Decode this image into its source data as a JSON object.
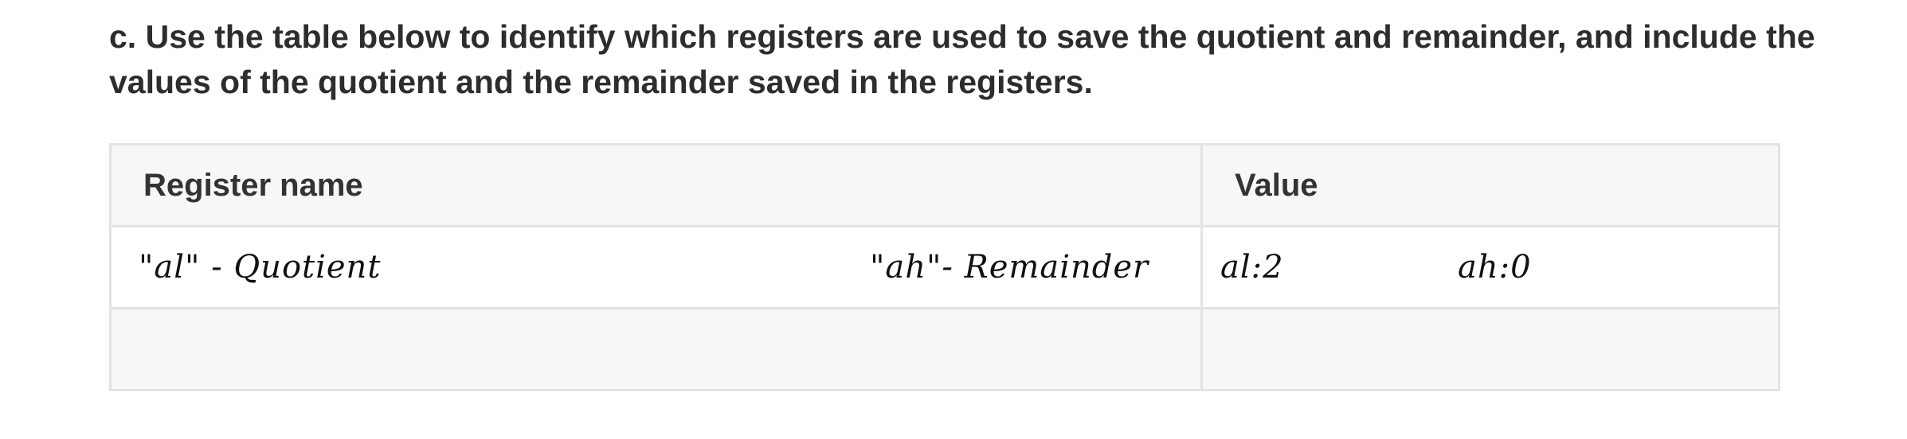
{
  "question": {
    "text": "c. Use the table below to identify which registers are used to save the quotient and remainder, and include the values of the quotient and the remainder saved in the registers."
  },
  "table": {
    "headers": {
      "register_name": "Register name",
      "value": "Value"
    },
    "rows": [
      {
        "name_quotient": "\"al\" - Quotient",
        "name_remainder": "\"ah\"- Remainder",
        "value_al": "al:2",
        "value_ah": "ah:0"
      },
      {
        "name": "",
        "value": ""
      }
    ]
  }
}
